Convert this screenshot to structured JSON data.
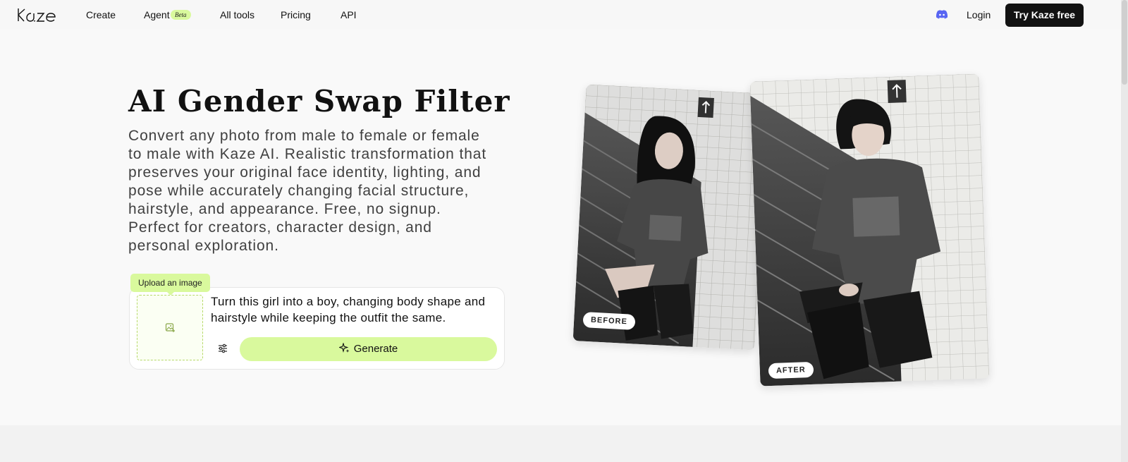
{
  "header": {
    "logo_text": "Kaze",
    "nav": {
      "create": "Create",
      "agent": "Agent",
      "agent_badge": "Beta",
      "all_tools": "All tools",
      "pricing": "Pricing",
      "api": "API"
    },
    "discord_icon": "discord-icon",
    "login": "Login",
    "cta": "Try Kaze free"
  },
  "hero": {
    "title": "AI Gender Swap Filter",
    "description": "Convert any photo from male to female or female to male with Kaze AI. Realistic transformation that preserves your original face identity, lighting, and pose while accurately changing facial structure, hairstyle, and appearance. Free, no signup. Perfect for creators, character design, and personal exploration."
  },
  "generator": {
    "upload_label": "Upload an image",
    "upload_icon": "image-add-icon",
    "prompt": "Turn this girl into a boy, changing body shape and hairstyle while keeping the outfit the same.",
    "settings_icon": "sliders-icon",
    "generate_label": "Generate",
    "generate_icon": "sparkle-icon"
  },
  "comparison": {
    "before_label": "BEFORE",
    "after_label": "AFTER"
  },
  "colors": {
    "accent": "#d9f99d",
    "cta_background": "#121212",
    "discord": "#5865f2"
  }
}
